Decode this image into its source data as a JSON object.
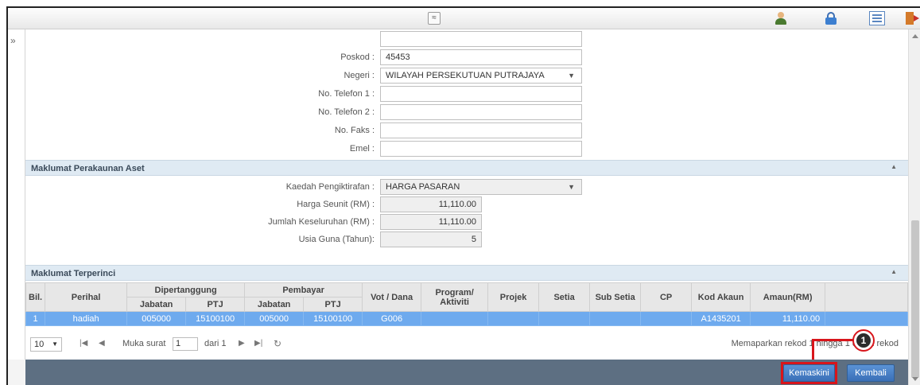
{
  "toolbar": {
    "collapse_glyph": "≈",
    "icons": [
      "user-icon",
      "lock-icon",
      "list-icon",
      "exit-icon"
    ]
  },
  "form": {
    "fields": [
      {
        "label": "",
        "value": ""
      },
      {
        "label": "Poskod :",
        "value": "45453"
      },
      {
        "label": "Negeri :",
        "value": "WILAYAH PERSEKUTUAN PUTRAJAYA",
        "type": "select"
      },
      {
        "label": "No. Telefon 1 :",
        "value": ""
      },
      {
        "label": "No. Telefon 2 :",
        "value": ""
      },
      {
        "label": "No. Faks :",
        "value": ""
      },
      {
        "label": "Emel :",
        "value": ""
      }
    ]
  },
  "perakaunan": {
    "title": "Maklumat Perakaunan Aset",
    "fields": [
      {
        "label": "Kaedah Pengiktirafan :",
        "value": "HARGA PASARAN",
        "type": "select"
      },
      {
        "label": "Harga Seunit (RM) :",
        "value": "11,110.00"
      },
      {
        "label": "Jumlah Keseluruhan (RM) :",
        "value": "11,110.00"
      },
      {
        "label": "Usia Guna (Tahun):",
        "value": "5"
      }
    ]
  },
  "terperinci": {
    "title": "Maklumat Terperinci",
    "headers": {
      "bil": "Bil.",
      "perihal": "Perihal",
      "dipertanggung": "Dipertanggung",
      "pembayar": "Pembayar",
      "jabatan": "Jabatan",
      "ptj": "PTJ",
      "vot": "Vot / Dana",
      "program": "Program/ Aktiviti",
      "projek": "Projek",
      "setia": "Setia",
      "subsetia": "Sub Setia",
      "cp": "CP",
      "kodakaun": "Kod Akaun",
      "amaun": "Amaun(RM)"
    },
    "row": {
      "bil": "1",
      "perihal": "hadiah",
      "dip_jabatan": "005000",
      "dip_ptj": "15100100",
      "pem_jabatan": "005000",
      "pem_ptj": "15100100",
      "vot": "G006",
      "program": "",
      "projek": "",
      "setia": "",
      "subsetia": "",
      "cp": "",
      "kodakaun": "A1435201",
      "amaun": "11,110.00"
    }
  },
  "pager": {
    "page_size": "10",
    "muka_surat": "Muka surat",
    "page": "1",
    "dari": "dari 1",
    "info": "Memaparkan rekod 1 hingga 1 dari 1 rekod"
  },
  "actions": {
    "kemaskini": "Kemaskini",
    "kembali": "Kembali"
  },
  "callout": {
    "number": "1",
    "color": "#d8151b"
  },
  "colors": {
    "selected_row": "#6eaaee",
    "section_header": "#dfeaf3",
    "bottom_bar": "#5d6f82"
  }
}
